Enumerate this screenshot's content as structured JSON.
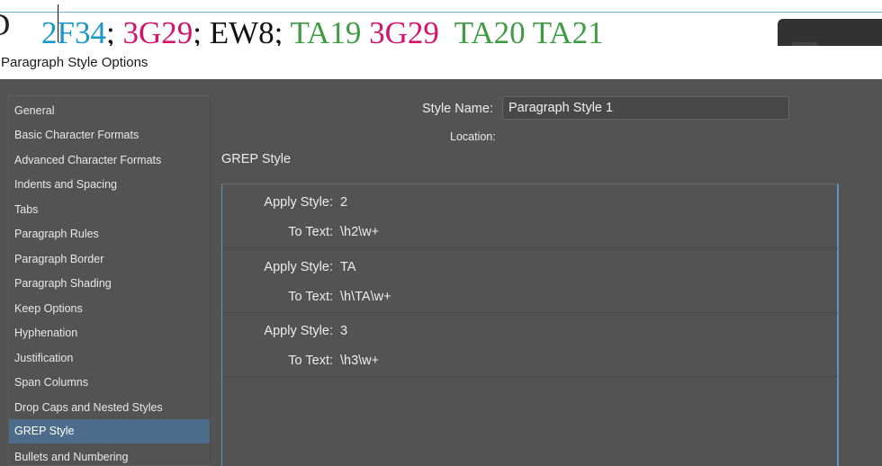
{
  "document": {
    "cut_glyph": "D",
    "tokens": [
      {
        "text": "2F34",
        "color": "#1b97c9"
      },
      {
        "text": ";",
        "color": "#111111"
      },
      {
        "text": " 3G29",
        "color": "#d3136c"
      },
      {
        "text": "; EW8;",
        "color": "#111111"
      },
      {
        "text": " TA19",
        "color": "#3f9c45"
      },
      {
        "text": " 3G29",
        "color": "#d3136c"
      },
      {
        "text": "  TA20 TA21",
        "color": "#3f9c45"
      }
    ]
  },
  "dialog": {
    "title": "Paragraph Style Options"
  },
  "sidebar": {
    "items": [
      {
        "label": "General"
      },
      {
        "label": "Basic Character Formats"
      },
      {
        "label": "Advanced Character Formats"
      },
      {
        "label": "Indents and Spacing"
      },
      {
        "label": "Tabs"
      },
      {
        "label": "Paragraph Rules"
      },
      {
        "label": "Paragraph Border"
      },
      {
        "label": "Paragraph Shading"
      },
      {
        "label": "Keep Options"
      },
      {
        "label": "Hyphenation"
      },
      {
        "label": "Justification"
      },
      {
        "label": "Span Columns"
      },
      {
        "label": "Drop Caps and Nested Styles"
      },
      {
        "label": "GREP Style",
        "selected": true
      },
      {
        "label": "Bullets and Numbering"
      }
    ]
  },
  "main": {
    "style_name_label": "Style Name:",
    "style_name_value": "Paragraph Style 1",
    "location_label": "Location:",
    "section_title": "GREP Style",
    "apply_style_label": "Apply Style:",
    "to_text_label": "To Text:",
    "rules": [
      {
        "apply_style": "2",
        "to_text": "\\h2\\w+"
      },
      {
        "apply_style": "TA",
        "to_text": "\\h\\TA\\w+"
      },
      {
        "apply_style": "3",
        "to_text": "\\h3\\w+"
      }
    ]
  }
}
